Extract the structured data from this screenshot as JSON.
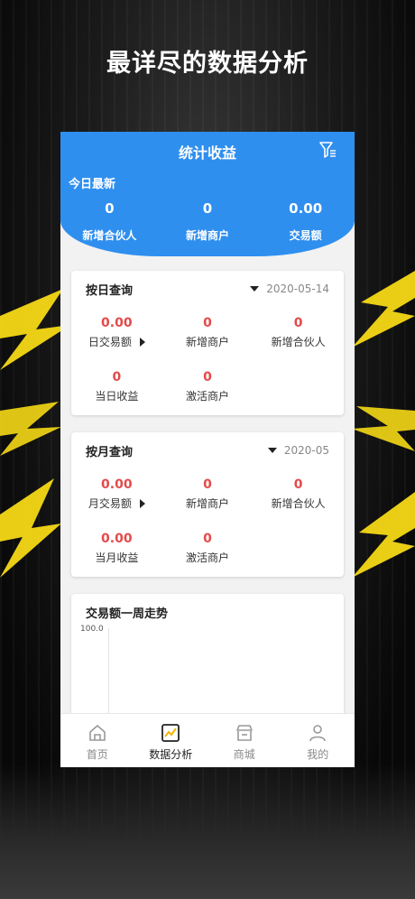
{
  "headline": "最详尽的数据分析",
  "header": {
    "title": "统计收益"
  },
  "today": {
    "label": "今日最新",
    "stats": [
      {
        "value": "0",
        "label": "新增合伙人"
      },
      {
        "value": "0",
        "label": "新增商户"
      },
      {
        "value": "0.00",
        "label": "交易额"
      }
    ]
  },
  "daily": {
    "title": "按日查询",
    "date": "2020-05-14",
    "cells": [
      {
        "value": "0.00",
        "label": "日交易额"
      },
      {
        "value": "0",
        "label": "新增商户"
      },
      {
        "value": "0",
        "label": "新增合伙人"
      },
      {
        "value": "0",
        "label": "当日收益"
      },
      {
        "value": "0",
        "label": "激活商户"
      }
    ]
  },
  "monthly": {
    "title": "按月查询",
    "date": "2020-05",
    "cells": [
      {
        "value": "0.00",
        "label": "月交易额"
      },
      {
        "value": "0",
        "label": "新增商户"
      },
      {
        "value": "0",
        "label": "新增合伙人"
      },
      {
        "value": "0.00",
        "label": "当月收益"
      },
      {
        "value": "0",
        "label": "激活商户"
      }
    ]
  },
  "trend": {
    "title": "交易额一周走势",
    "axis_max": "100.0"
  },
  "tabs": [
    {
      "label": "首页",
      "icon": "home-icon",
      "active": false
    },
    {
      "label": "数据分析",
      "icon": "chart-icon",
      "active": true
    },
    {
      "label": "商城",
      "icon": "store-icon",
      "active": false
    },
    {
      "label": "我的",
      "icon": "user-icon",
      "active": false
    }
  ],
  "colors": {
    "primary": "#2f8fef",
    "value_red": "#e34a4a",
    "bolt": "#f5d916"
  }
}
